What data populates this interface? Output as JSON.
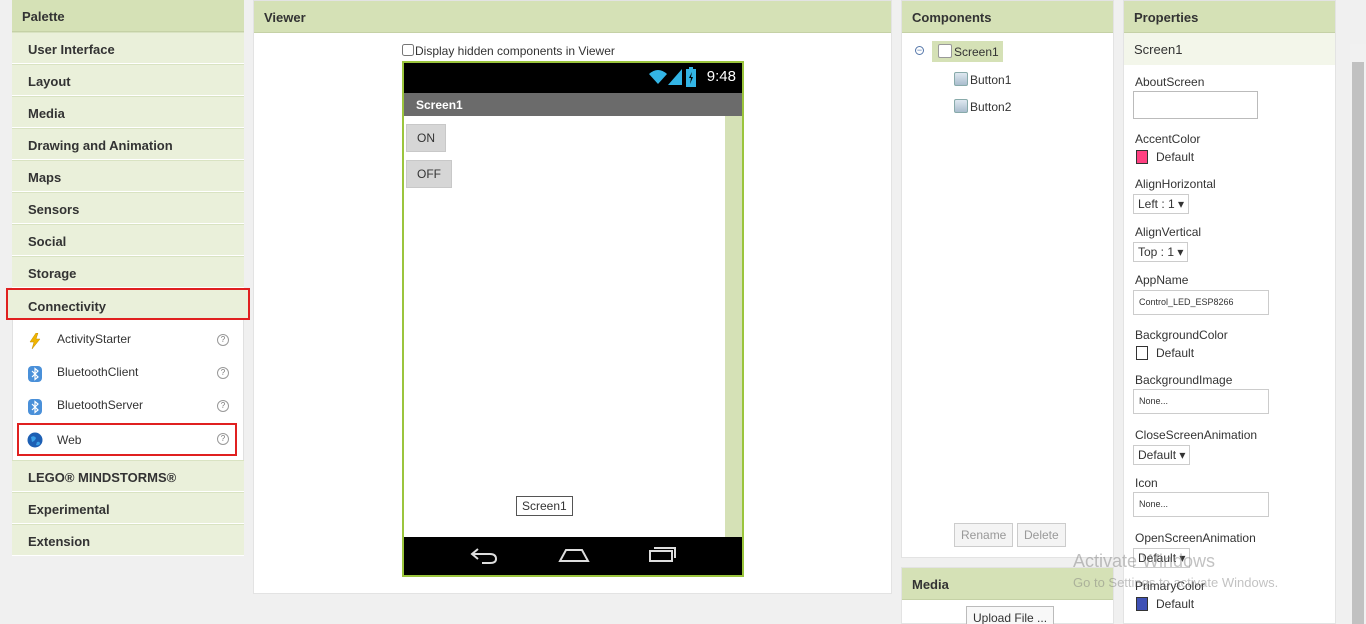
{
  "palette": {
    "title": "Palette",
    "categories_top": [
      "User Interface",
      "Layout",
      "Media",
      "Drawing and Animation",
      "Maps",
      "Sensors",
      "Social",
      "Storage"
    ],
    "active_category": "Connectivity",
    "items": [
      {
        "label": "ActivityStarter",
        "icon": "lightning-icon"
      },
      {
        "label": "BluetoothClient",
        "icon": "bluetooth-icon"
      },
      {
        "label": "BluetoothServer",
        "icon": "bluetooth-icon"
      },
      {
        "label": "Web",
        "icon": "globe-icon"
      }
    ],
    "help_glyph": "?",
    "categories_bottom": [
      "LEGO® MINDSTORMS®",
      "Experimental",
      "Extension"
    ]
  },
  "viewer": {
    "title": "Viewer",
    "hidden_checkbox_label": "Display hidden components in Viewer",
    "phone": {
      "time": "9:48",
      "screen_title": "Screen1",
      "button1": "ON",
      "button2": "OFF",
      "screen_tag": "Screen1"
    }
  },
  "components": {
    "title": "Components",
    "tree": {
      "root": "Screen1",
      "children": [
        "Button1",
        "Button2"
      ]
    },
    "toggle_glyph": "−",
    "rename_label": "Rename",
    "delete_label": "Delete"
  },
  "media": {
    "title": "Media",
    "upload_label": "Upload File ..."
  },
  "properties": {
    "title": "Properties",
    "selected": "Screen1",
    "about_screen": "AboutScreen",
    "accent_color": {
      "label": "AccentColor",
      "value": "Default",
      "color": "#ff4081"
    },
    "align_horizontal": {
      "label": "AlignHorizontal",
      "value": "Left : 1 ▾"
    },
    "align_vertical": {
      "label": "AlignVertical",
      "value": "Top : 1 ▾"
    },
    "app_name": {
      "label": "AppName",
      "value": "Control_LED_ESP8266"
    },
    "background_color": {
      "label": "BackgroundColor",
      "value": "Default",
      "color": "#ffffff"
    },
    "background_image": {
      "label": "BackgroundImage",
      "value": "None..."
    },
    "close_anim": {
      "label": "CloseScreenAnimation",
      "value": "Default ▾"
    },
    "icon": {
      "label": "Icon",
      "value": "None..."
    },
    "open_anim": {
      "label": "OpenScreenAnimation",
      "value": "Default ▾"
    },
    "primary_color": {
      "label": "PrimaryColor",
      "value": "Default",
      "color": "#3f51b5"
    }
  },
  "watermark": {
    "line1": "Activate Windows",
    "line2": "Go to Settings to activate Windows."
  }
}
